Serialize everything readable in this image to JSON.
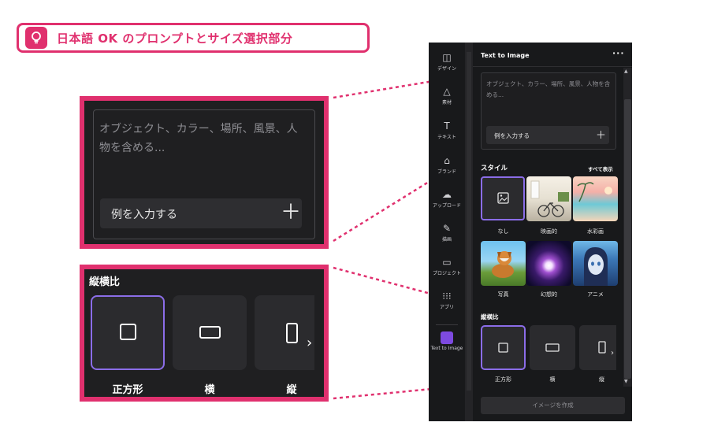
{
  "badge": {
    "text": "日本語 OK のプロンプトとサイズ選択部分",
    "icon": "lightbulb-icon"
  },
  "zoom_prompt": {
    "placeholder": "オブジェクト、カラー、場所、風景、人物を含める...",
    "example_label": "例を入力する",
    "plus_label": "＋"
  },
  "zoom_aspect": {
    "title": "縦横比",
    "options": [
      "正方形",
      "横",
      "縦"
    ]
  },
  "sidebar": {
    "items": [
      {
        "label": "デザイン",
        "icon": "layout-icon"
      },
      {
        "label": "素材",
        "icon": "shapes-icon"
      },
      {
        "label": "テキスト",
        "icon": "text-icon"
      },
      {
        "label": "ブランド",
        "icon": "brand-icon"
      },
      {
        "label": "アップロード",
        "icon": "upload-icon"
      },
      {
        "label": "描画",
        "icon": "draw-icon"
      },
      {
        "label": "プロジェクト",
        "icon": "folder-icon"
      },
      {
        "label": "アプリ",
        "icon": "apps-icon"
      },
      {
        "label": "Text to Image",
        "icon": "text-to-image-icon"
      }
    ]
  },
  "panel": {
    "title": "Text to Image",
    "more": "···",
    "placeholder": "オブジェクト、カラー、場所、風景、人物を含める...",
    "example_label": "例を入力する",
    "plus_label": "＋",
    "style_title": "スタイル",
    "style_all": "すべて表示",
    "styles": [
      "なし",
      "映画的",
      "水彩画",
      "写真",
      "幻想的",
      "アニメ"
    ],
    "aspect_title": "縦横比",
    "aspects": [
      "正方形",
      "横",
      "縦"
    ],
    "generate_label": "イメージを作成"
  },
  "colors": {
    "accent": "#e0306e",
    "selected": "#8b6de8",
    "panel_bg": "#18191b"
  }
}
